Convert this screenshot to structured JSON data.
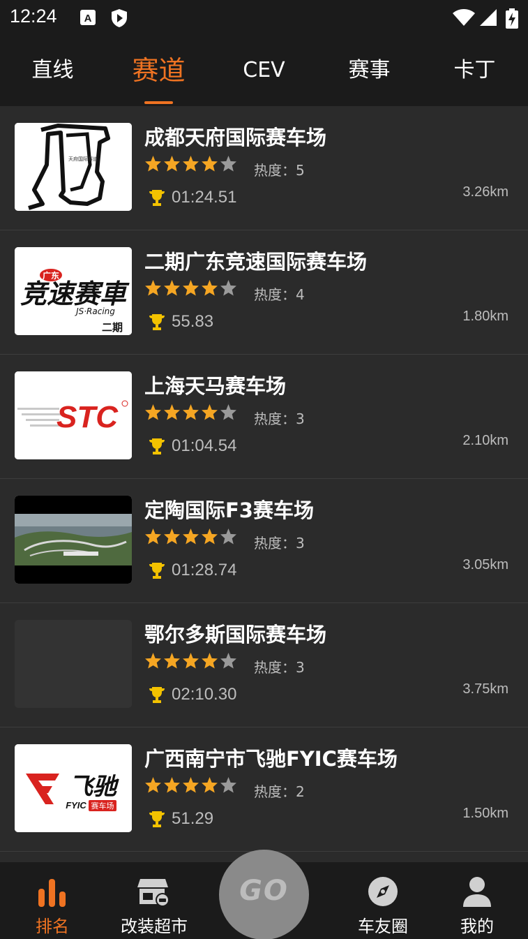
{
  "status_bar": {
    "time": "12:24"
  },
  "tabs": [
    {
      "label": "直线",
      "active": false
    },
    {
      "label": "赛道",
      "active": true
    },
    {
      "label": "CEV",
      "active": false
    },
    {
      "label": "赛事",
      "active": false
    },
    {
      "label": "卡丁",
      "active": false
    }
  ],
  "tracks": [
    {
      "name": "成都天府国际赛车场",
      "rating": 4,
      "heat_label": "热度：5",
      "best_lap": "01:24.51",
      "distance": "3.26km",
      "thumb": "tianfu-track-map",
      "thumb_text": "天府国际赛道"
    },
    {
      "name": "二期广东竞速国际赛车场",
      "rating": 4,
      "heat_label": "热度：4",
      "best_lap": "55.83",
      "distance": "1.80km",
      "thumb": "js-racing-logo",
      "thumb_text": "竞速赛車",
      "thumb_sub": "JS·Racing",
      "thumb_badge": "广东",
      "thumb_phase": "二期"
    },
    {
      "name": "上海天马赛车场",
      "rating": 4,
      "heat_label": "热度：3",
      "best_lap": "01:04.54",
      "distance": "2.10km",
      "thumb": "stc-logo",
      "thumb_text": "STC"
    },
    {
      "name": "定陶国际F3赛车场",
      "rating": 4,
      "heat_label": "热度：3",
      "best_lap": "01:28.74",
      "distance": "3.05km",
      "thumb": "aerial-photo"
    },
    {
      "name": "鄂尔多斯国际赛车场",
      "rating": 4,
      "heat_label": "热度：3",
      "best_lap": "02:10.30",
      "distance": "3.75km",
      "thumb": "empty"
    },
    {
      "name": "广西南宁市飞驰FYIC赛车场",
      "rating": 4,
      "heat_label": "热度：2",
      "best_lap": "51.29",
      "distance": "1.50km",
      "thumb": "fyic-logo",
      "thumb_text": "飞驰",
      "thumb_sub": "FYIC",
      "thumb_badge": "赛车场"
    }
  ],
  "bottom_nav": {
    "items": [
      {
        "label": "排名",
        "icon": "bar-chart-icon",
        "active": true
      },
      {
        "label": "改装超市",
        "icon": "shop-icon",
        "active": false
      },
      {
        "label": "车友圈",
        "icon": "compass-icon",
        "active": false
      },
      {
        "label": "我的",
        "icon": "user-icon",
        "active": false
      }
    ],
    "go_label": "GO"
  },
  "colors": {
    "accent": "#ef7322",
    "star": "#f5a623",
    "star_empty": "#9a9a9a",
    "trophy": "#f3c200"
  }
}
